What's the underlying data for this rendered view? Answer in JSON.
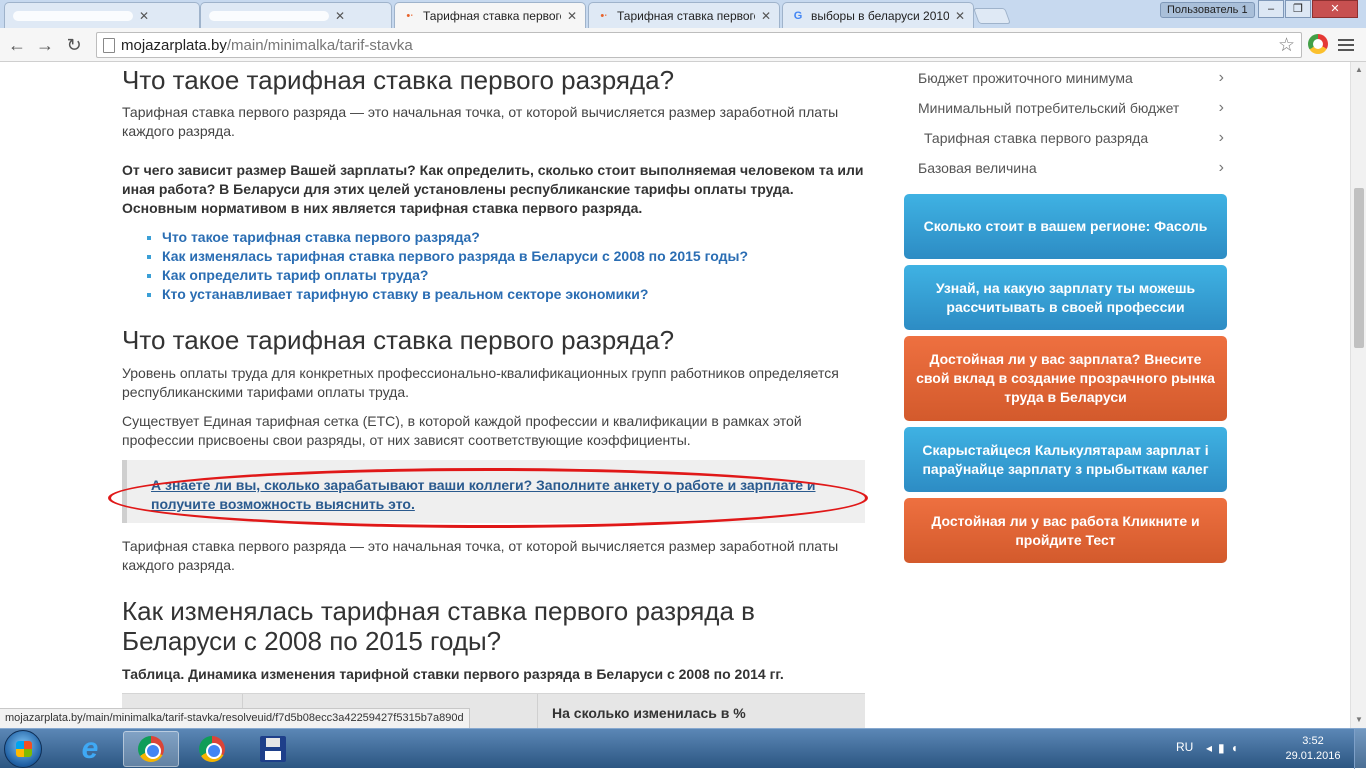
{
  "browser": {
    "tabs": [
      {
        "title": "",
        "redacted": true
      },
      {
        "title": "",
        "redacted": true
      },
      {
        "title": "Тарифная ставка первого",
        "active": true
      },
      {
        "title": "Тарифная ставка первого"
      },
      {
        "title": "выборы в беларуси 2010"
      }
    ],
    "user_badge": "Пользователь 1",
    "url_host": "mojazarplata.by",
    "url_path": "/main/minimalka/tarif-stavka"
  },
  "article": {
    "heading1": "Что такое тарифная ставка первого разряда?",
    "intro": "Тарифная ставка первого разряда — это начальная точка, от которой вычисляется размер заработной платы каждого разряда.",
    "lead": "От чего зависит размер Вашей зарплаты? Как определить, сколько стоит выполняемая человеком та или иная работа? В Беларуси для этих целей установлены республиканские тарифы оплаты труда. Основным нормативом в них является тарифная ставка первого разряда.",
    "toc": [
      "Что такое тарифная ставка первого разряда?",
      "Как изменялась тарифная ставка первого разряда в Беларуси с 2008 по 2015 годы?",
      "Как определить тариф оплаты труда?",
      "Кто устанавливает тарифную ставку в реальном секторе экономики?"
    ],
    "heading2": "Что такое тарифная ставка первого разряда?",
    "para1": "Уровень оплаты труда для конкретных профессионально-квалификационных групп работников определяется республиканскими тарифами оплаты труда.",
    "para2": "Существует Единая тарифная сетка (ЕТС), в которой каждой профессии и квалификации в рамках этой профессии присвоены свои разряды, от них зависят соответствующие коэффициенты.",
    "callout": "А знаете ли вы, сколько зарабатывают ваши коллеги? Заполните анкету о работе и зарплате и получите возможность выяснить это.",
    "para3": "Тарифная ставка первого разряда — это начальная точка, от которой вычисляется размер заработной платы каждого разряда.",
    "heading3": "Как изменялась тарифная ставка первого разряда в Беларуси с 2008 по 2015 годы?",
    "table_caption": "Таблица. Динамика изменения тарифной ставки первого разряда в Беларуси с 2008 по 2014 гг.",
    "table_header": "На сколько изменилась в %"
  },
  "sidebar": {
    "menu": [
      "Бюджет прожиточного минимума",
      "Минимальный потребительский бюджет",
      "Тарифная ставка первого разряда",
      "Базовая величина"
    ],
    "ctas": [
      {
        "text": "Сколько стоит в вашем регионе: Фасоль",
        "color": "#2d8cc4"
      },
      {
        "text": "Узнай, на какую зарплату ты можешь рассчитывать в своей профессии",
        "color": "#2d8cc4"
      },
      {
        "text": "Достойная ли у вас зарплата? Внесите свой вклад в создание прозрачного рынка труда в Беларуси",
        "color": "#d35a2c"
      },
      {
        "text": "Скарыстайцеся Калькулятарам зарплат і параўнайце зарплату з прыбыткам калег",
        "color": "#2d8cc4"
      },
      {
        "text": "Достойная ли у вас работа Кликните и пройдите Тест",
        "color": "#d35a2c"
      }
    ]
  },
  "status_url": "mojazarplata.by/main/minimalka/tarif-stavka/resolveuid/f7d5b08ecc3a42259427f5315b7a890d",
  "taskbar": {
    "lang": "RU",
    "time": "3:52",
    "date": "29.01.2016",
    "apps": [
      "internet-explorer",
      "chrome",
      "chrome",
      "floppy-disk"
    ]
  },
  "colors": {
    "link": "#2a6db3",
    "cta_blue": "#2d8cc4",
    "cta_orange": "#d35a2c",
    "annotation_ring": "#e01818"
  }
}
